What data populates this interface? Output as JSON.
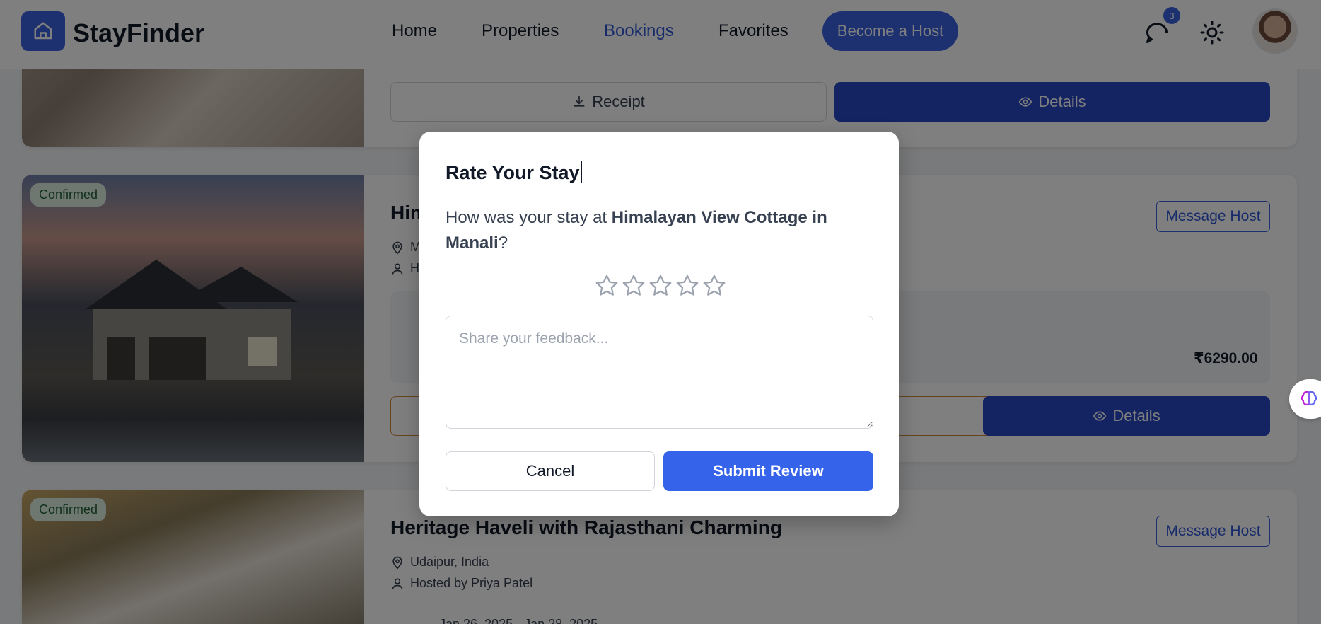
{
  "header": {
    "brand": "StayFinder",
    "nav": {
      "home": "Home",
      "properties": "Properties",
      "bookings": "Bookings",
      "favorites": "Favorites"
    },
    "become_host": "Become a Host",
    "notification_count": "3",
    "icons": [
      "home-icon",
      "chat-icon",
      "sun-icon"
    ],
    "colors": {
      "accent": "#3b63e0",
      "active_nav": "#2f56d6"
    }
  },
  "bookings": [
    {
      "receipt_label": "Receipt",
      "details_label": "Details"
    },
    {
      "status": "Confirmed",
      "title_partial": "Him",
      "location_partial": "M",
      "host_partial": "H",
      "message_host": "Message Host",
      "price": "₹6290.00",
      "details_label": "Details"
    },
    {
      "status": "Confirmed",
      "title": "Heritage Haveli with Rajasthani Charming",
      "location": "Udaipur, India",
      "host": "Hosted by Priya Patel",
      "message_host": "Message Host",
      "dates_partial": "Jan 26, 2025 - Jan 28, 2025"
    }
  ],
  "modal": {
    "title": "Rate Your Stay",
    "question_prefix": "How was your stay at ",
    "property_name": "Himalayan View Cottage in Manali",
    "question_suffix": "?",
    "rating": 0,
    "max_rating": 5,
    "feedback_placeholder": "Share your feedback...",
    "cancel_label": "Cancel",
    "submit_label": "Submit Review",
    "colors": {
      "submit": "#3563e9"
    }
  }
}
